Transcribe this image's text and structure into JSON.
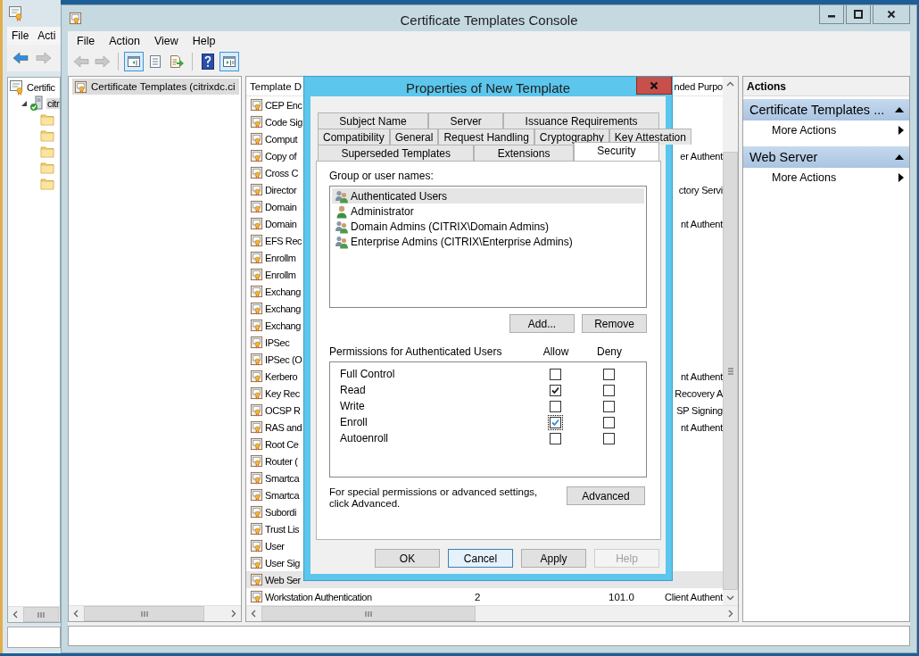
{
  "back_window": {
    "menu": [
      {
        "label": "File"
      },
      {
        "label": "Acti"
      }
    ],
    "toolbar": [
      {
        "kind": "back",
        "disabled": false
      },
      {
        "kind": "forward",
        "disabled": true
      }
    ],
    "tree": [
      {
        "label": "Certific",
        "kind": "authority",
        "selected": false,
        "children": [
          {
            "label": "citr",
            "kind": "server",
            "selected": true,
            "expanded": true,
            "children": [
              {
                "kind": "folder"
              },
              {
                "kind": "folder"
              },
              {
                "kind": "folder"
              },
              {
                "kind": "folder"
              },
              {
                "kind": "folder"
              }
            ]
          }
        ]
      }
    ]
  },
  "main_window": {
    "title": "Certificate Templates Console",
    "menu": [
      {
        "label": "File"
      },
      {
        "label": "Action"
      },
      {
        "label": "View"
      },
      {
        "label": "Help"
      }
    ],
    "toolbar": [
      [
        {
          "kind": "back",
          "disabled": true,
          "pressed": false
        },
        {
          "kind": "forward",
          "disabled": true,
          "pressed": false
        }
      ],
      [
        {
          "kind": "console-tree",
          "disabled": false,
          "pressed": true
        },
        {
          "kind": "properties",
          "disabled": false,
          "pressed": false
        },
        {
          "kind": "export",
          "disabled": false,
          "pressed": false
        }
      ],
      [
        {
          "kind": "help",
          "disabled": false,
          "pressed": false
        },
        {
          "kind": "action-pane",
          "disabled": false,
          "pressed": true
        }
      ]
    ],
    "tree": [
      {
        "label": "Certificate Templates (citrixdc.ci",
        "selected": true
      }
    ],
    "list": {
      "columns": [
        {
          "label": "Template D"
        },
        {
          "label": "nded Purpo"
        }
      ],
      "rows": [
        {
          "name": "CEP Enc",
          "selected": false
        },
        {
          "name": "Code Sig",
          "selected": false
        },
        {
          "name": "Comput",
          "selected": false
        },
        {
          "name": "Copy of",
          "column_4": "er Authent",
          "selected": false
        },
        {
          "name": "Cross C",
          "selected": false
        },
        {
          "name": "Director",
          "column_4": "ctory Servi",
          "selected": false
        },
        {
          "name": "Domain",
          "selected": false
        },
        {
          "name": "Domain",
          "column_4": "nt Authent",
          "selected": false
        },
        {
          "name": "EFS Rec",
          "selected": false
        },
        {
          "name": "Enrollm",
          "selected": false
        },
        {
          "name": "Enrollm",
          "selected": false
        },
        {
          "name": "Exchang",
          "selected": false
        },
        {
          "name": "Exchang",
          "selected": false
        },
        {
          "name": "Exchang",
          "selected": false
        },
        {
          "name": "IPSec",
          "selected": false
        },
        {
          "name": "IPSec (O",
          "selected": false
        },
        {
          "name": "Kerbero",
          "column_4": "nt Authent",
          "selected": false
        },
        {
          "name": "Key Rec",
          "column_4": "Recovery A",
          "selected": false
        },
        {
          "name": "OCSP R",
          "column_4": "SP Signing",
          "selected": false
        },
        {
          "name": "RAS and",
          "column_4": "nt Authent",
          "selected": false
        },
        {
          "name": "Root Ce",
          "selected": false
        },
        {
          "name": "Router (",
          "selected": false
        },
        {
          "name": "Smartca",
          "selected": false
        },
        {
          "name": "Smartca",
          "selected": false
        },
        {
          "name": "Subordi",
          "selected": false
        },
        {
          "name": "Trust Lis",
          "selected": false
        },
        {
          "name": "User",
          "selected": false
        },
        {
          "name": "User Sig",
          "selected": false
        },
        {
          "name": "Web Ser",
          "selected": true
        },
        {
          "name": "Workstation Authentication",
          "column_2": "2",
          "column_3": "101.0",
          "column_4": "Client Authent",
          "selected": false
        }
      ]
    },
    "actions": {
      "title": "Actions",
      "sections": [
        {
          "title": "Certificate Templates ...",
          "expanded": true,
          "items": [
            {
              "label": "More Actions"
            }
          ]
        },
        {
          "title": "Web Server",
          "expanded": true,
          "items": [
            {
              "label": "More Actions"
            }
          ]
        }
      ]
    }
  },
  "dialog": {
    "title": "Properties of New Template",
    "tab_rows": [
      [
        {
          "label": "Subject Name",
          "selected": false
        },
        {
          "label": "Server",
          "selected": false
        },
        {
          "label": "Issuance Requirements",
          "selected": false
        }
      ],
      [
        {
          "label": "Compatibility",
          "selected": false
        },
        {
          "label": "General",
          "selected": false
        },
        {
          "label": "Request Handling",
          "selected": false
        },
        {
          "label": "Cryptography",
          "selected": false
        },
        {
          "label": "Key Attestation",
          "selected": false
        }
      ],
      [
        {
          "label": "Superseded Templates",
          "selected": false
        },
        {
          "label": "Extensions",
          "selected": false
        },
        {
          "label": "Security",
          "selected": true
        }
      ]
    ],
    "group_label": "Group or user names:",
    "principals": [
      {
        "name": "Authenticated Users",
        "kind": "group",
        "selected": true
      },
      {
        "name": "Administrator",
        "kind": "user",
        "selected": false
      },
      {
        "name": "Domain Admins (CITRIX\\Domain Admins)",
        "kind": "group",
        "selected": false
      },
      {
        "name": "Enterprise Admins (CITRIX\\Enterprise Admins)",
        "kind": "group",
        "selected": false
      }
    ],
    "principal_buttons": [
      {
        "label": "Add..."
      },
      {
        "label": "Remove"
      }
    ],
    "permissions_label": "Permissions for Authenticated Users",
    "allow_header": "Allow",
    "deny_header": "Deny",
    "permissions": [
      {
        "name": "Full Control",
        "allow": false,
        "deny": false,
        "focused": false
      },
      {
        "name": "Read",
        "allow": true,
        "deny": false,
        "focused": false
      },
      {
        "name": "Write",
        "allow": false,
        "deny": false,
        "focused": false
      },
      {
        "name": "Enroll",
        "allow": true,
        "deny": false,
        "focused": true
      },
      {
        "name": "Autoenroll",
        "allow": false,
        "deny": false,
        "focused": false
      }
    ],
    "note": "For special permissions or advanced settings, click Advanced.",
    "advanced_button": "Advanced",
    "buttons": [
      {
        "label": "OK",
        "focused": false,
        "disabled": false
      },
      {
        "label": "Cancel",
        "focused": true,
        "disabled": false
      },
      {
        "label": "Apply",
        "focused": false,
        "disabled": false
      },
      {
        "label": "Help",
        "focused": false,
        "disabled": true
      }
    ]
  }
}
